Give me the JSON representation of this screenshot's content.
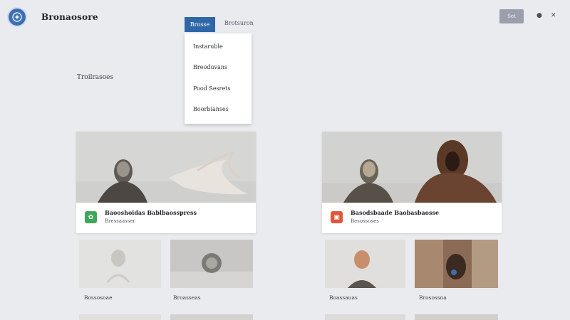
{
  "header": {
    "title": "Bronaosore",
    "tabs": [
      {
        "label": "Brosse"
      },
      {
        "label": "Brotsuron"
      }
    ],
    "action_button": "Set",
    "icons": [
      "settings-icon",
      "close-icon"
    ]
  },
  "dropdown": {
    "items": [
      "Instaruble",
      "Breoduvans",
      "Pood Sesrets",
      "Boorbianses"
    ]
  },
  "section": {
    "label": "Troilrasoes"
  },
  "featured": [
    {
      "title": "Baooshoidas  Bablbaosspress",
      "subtitle": "Bressaasser",
      "badge_color": "#3fa75a",
      "badge_icon": "leaf-icon"
    },
    {
      "title": "Basodsbaade  Baobasbaosse",
      "subtitle": "Besossoses",
      "badge_color": "#e0573a",
      "badge_icon": "image-icon"
    }
  ],
  "thumbnails": [
    {
      "caption": "Bossosoae"
    },
    {
      "caption": "Broasseas"
    },
    {
      "caption": "Boassauas"
    },
    {
      "caption": "Brosossoa"
    }
  ]
}
